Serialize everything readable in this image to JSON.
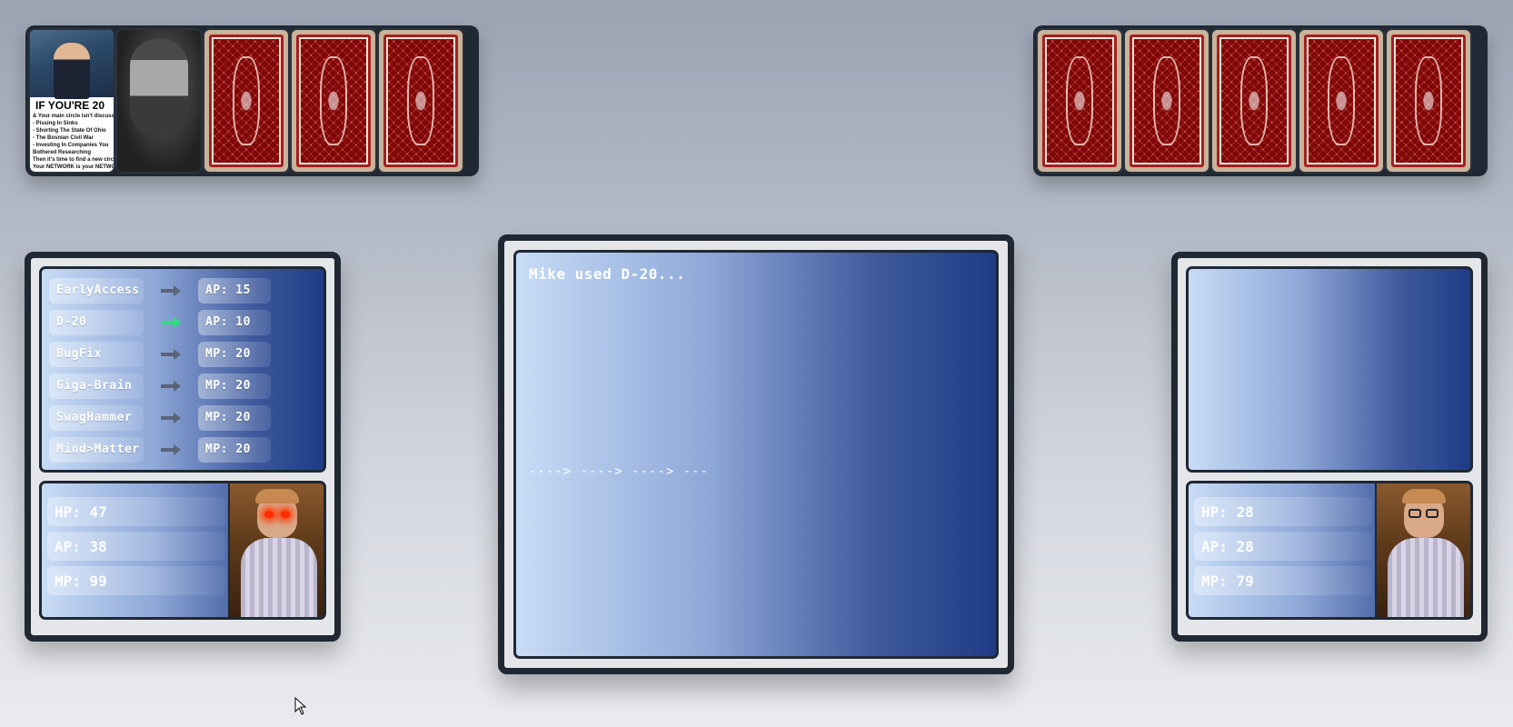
{
  "player_hand": {
    "cards": [
      {
        "type": "meme",
        "headline": "IF YOU'RE 20",
        "lines": [
          "& Your main circle isn't discussing",
          "- Pissing In Sinks",
          "- Shorting The State Of Ohio",
          "- The Bosnian Civil War",
          "- Investing In Companies You",
          "  Bothered Researching",
          "  Then it's time to find a new circle",
          "  Your NETWORK is your NETWORTH"
        ]
      },
      {
        "type": "chad"
      },
      {
        "type": "back"
      },
      {
        "type": "back"
      },
      {
        "type": "back"
      }
    ]
  },
  "enemy_hand": {
    "cards": [
      {
        "type": "back"
      },
      {
        "type": "back"
      },
      {
        "type": "back"
      },
      {
        "type": "back"
      },
      {
        "type": "back"
      }
    ]
  },
  "player": {
    "skills": [
      {
        "name": "EarlyAccess",
        "cost": "AP: 15",
        "active": false
      },
      {
        "name": "D-20",
        "cost": "AP: 10",
        "active": true
      },
      {
        "name": "BugFix",
        "cost": "MP: 20",
        "active": false
      },
      {
        "name": "Giga-Brain",
        "cost": "MP: 20",
        "active": false
      },
      {
        "name": "SwagHammer",
        "cost": "MP: 20",
        "active": false
      },
      {
        "name": "Mind>Matter",
        "cost": "MP: 20",
        "active": false
      }
    ],
    "stats": {
      "hp": "HP: 47",
      "ap": "AP: 38",
      "mp": "MP: 99"
    }
  },
  "enemy": {
    "stats": {
      "hp": "HP: 28",
      "ap": "AP: 28",
      "mp": "MP: 79"
    }
  },
  "log": {
    "message": "Mike used D-20...",
    "progress": "----> ----> ----> ---"
  },
  "colors": {
    "arrow_active": "#2ee07a",
    "arrow_inactive": "#5a6478",
    "frame": "#1f2833"
  }
}
